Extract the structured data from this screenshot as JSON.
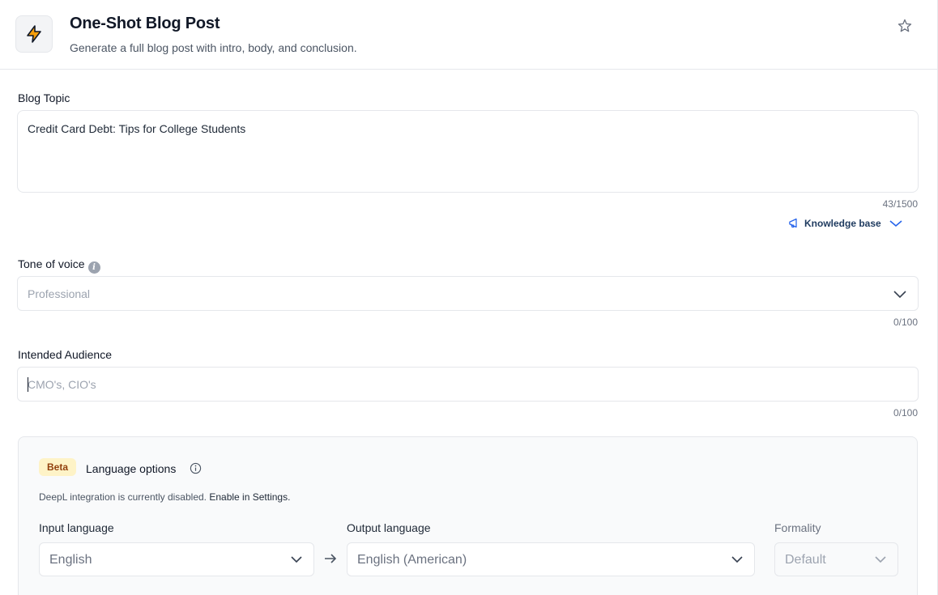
{
  "header": {
    "title": "One-Shot Blog Post",
    "subtitle": "Generate a full blog post with intro, body, and conclusion.",
    "icon": "lightning-bolt-icon",
    "favorite_icon": "star-icon"
  },
  "blog_topic": {
    "label": "Blog Topic",
    "value": "Credit Card Debt: Tips for College Students",
    "counter": "43/1500"
  },
  "knowledge_base": {
    "label": "Knowledge base",
    "icon": "megaphone-icon"
  },
  "tone": {
    "label": "Tone of voice",
    "info": "i",
    "selected": "Professional",
    "counter": "0/100"
  },
  "audience": {
    "label": "Intended Audience",
    "placeholder": "CMO's, CIO's",
    "counter": "0/100"
  },
  "language_options": {
    "badge": "Beta",
    "title": "Language options",
    "notice": "DeepL integration is currently disabled.",
    "notice_link": "Enable in Settings.",
    "input_label": "Input language",
    "input_value": "English",
    "output_label": "Output language",
    "output_value": "English (American)",
    "formality_label": "Formality",
    "formality_value": "Default"
  },
  "colors": {
    "accent_badge_bg": "#fef3c7",
    "accent_badge_text": "#92400e",
    "link_text": "#1e3a5f",
    "bolt_fill": "#f59e0b"
  }
}
